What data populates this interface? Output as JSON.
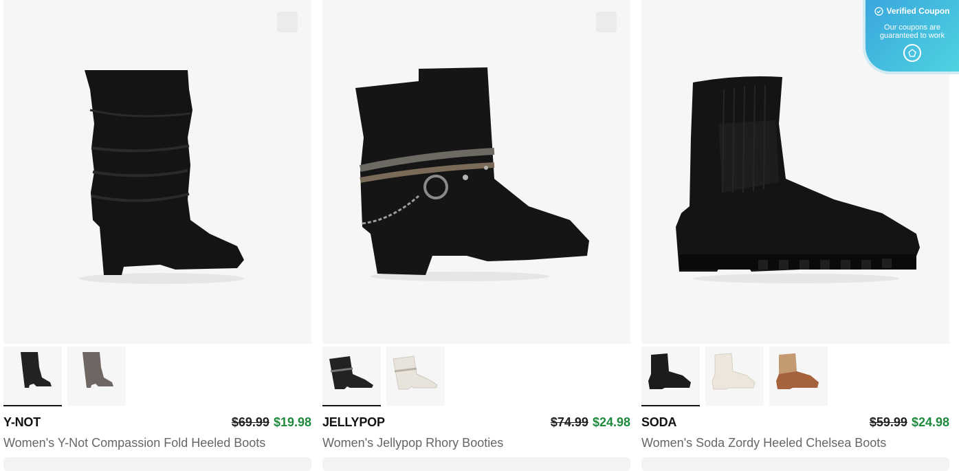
{
  "products": [
    {
      "brand": "Y-NOT",
      "name": "Women's Y-Not Compassion Fold Heeled Boots",
      "old_price": "$69.99",
      "new_price": "$19.98",
      "colors": [
        "#222222",
        "#6e6662"
      ]
    },
    {
      "brand": "JELLYPOP",
      "name": "Women's Jellypop Rhory Booties",
      "old_price": "$74.99",
      "new_price": "$24.98",
      "colors": [
        "#222222",
        "#e8e4dc"
      ]
    },
    {
      "brand": "SODA",
      "name": "Women's Soda Zordy Heeled Chelsea Boots",
      "old_price": "$59.99",
      "new_price": "$24.98",
      "colors": [
        "#1c1c1c",
        "#ece6dc",
        "#a5623c"
      ]
    }
  ],
  "coupon": {
    "title": "Verified Coupon",
    "subtitle": "Our coupons are guaranteed to work"
  }
}
